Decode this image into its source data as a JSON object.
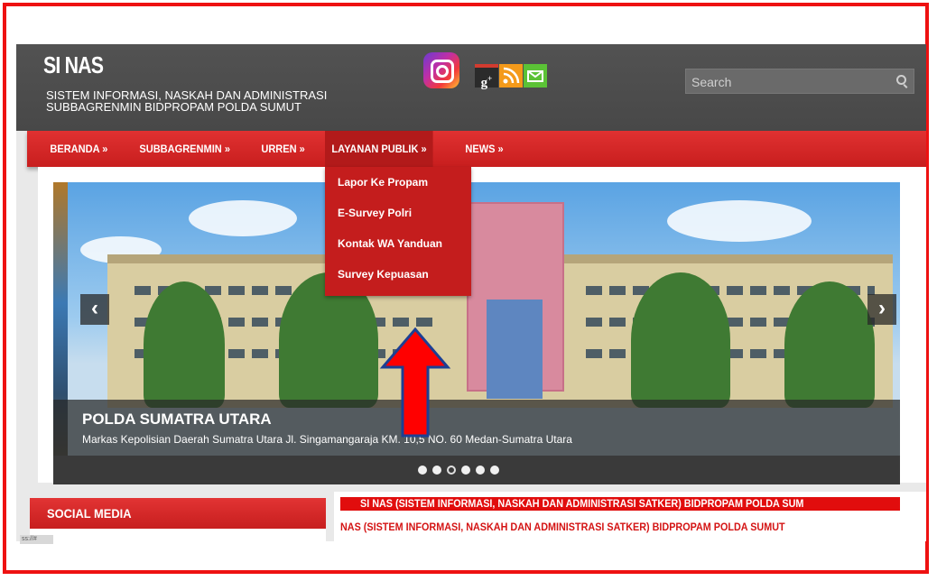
{
  "site": {
    "title": "SI NAS",
    "subtitle_line1": "SISTEM INFORMASI, NASKAH DAN ADMINISTRASI",
    "subtitle_line2": "SUBBAGRENMIN BIDPROPAM POLDA SUMUT"
  },
  "social_icons": [
    "instagram-icon",
    "google-plus-icon",
    "rss-icon",
    "mail-icon"
  ],
  "search": {
    "placeholder": "Search"
  },
  "nav": {
    "items": [
      {
        "label": "BERANDA »"
      },
      {
        "label": "SUBBAGRENMIN »"
      },
      {
        "label": "URREN »"
      },
      {
        "label": "LAYANAN PUBLIK »"
      },
      {
        "label": "NEWS »"
      }
    ],
    "active_index": 3
  },
  "dropdown": {
    "items": [
      {
        "label": "Lapor Ke Propam"
      },
      {
        "label": "E-Survey Polri"
      },
      {
        "label": "Kontak WA Yanduan"
      },
      {
        "label": "Survey Kepuasan"
      }
    ]
  },
  "slider": {
    "caption_title": "POLDA SUMATRA UTARA",
    "caption_text": "Markas Kepolisian Daerah Sumatra Utara Jl. Singamangaraja KM. 10,5 NO. 60 Medan-Sumatra Utara",
    "prev_label": "‹",
    "next_label": "›",
    "slide_count": 6,
    "active_slide": 3
  },
  "sidebar": {
    "social_media_title": "SOCIAL MEDIA"
  },
  "ticker": {
    "bar_text": "SI NAS (SISTEM INFORMASI, NASKAH DAN ADMINISTRASI SATKER) BIDPROPAM POLDA SUM",
    "line_text": "NAS (SISTEM INFORMASI, NASKAH DAN ADMINISTRASI SATKER) BIDPROPAM POLDA SUMUT"
  },
  "status_tag": "ss://#",
  "colors": {
    "frame_border": "#ee1111",
    "header_bg": "#4f4f4f",
    "nav_red": "#d42727",
    "dropdown_red": "#c41d1d",
    "annotation_arrow": "#ff0000"
  }
}
